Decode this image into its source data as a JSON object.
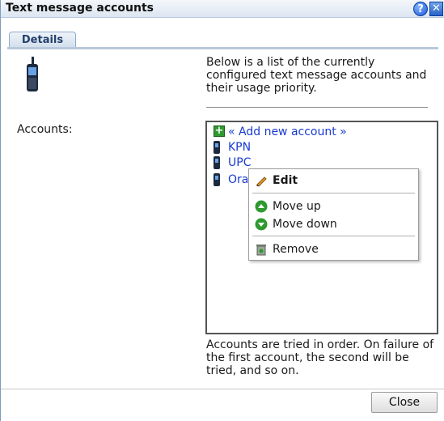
{
  "window": {
    "title": "Text message accounts"
  },
  "tabs": [
    {
      "label": "Details"
    }
  ],
  "intro_text": "Below is a list of the currently configured text message accounts and their usage priority.",
  "accounts_label": "Accounts:",
  "accounts_list": {
    "add_new_label": "« Add new account »",
    "items": [
      {
        "label": "KPN"
      },
      {
        "label": "UPC"
      },
      {
        "label": "Ora"
      }
    ]
  },
  "context_menu": {
    "edit_label": "Edit",
    "move_up_label": "Move up",
    "move_down_label": "Move down",
    "remove_label": "Remove"
  },
  "note": "Accounts are tried in order. On failure of the first account, the second will be tried, and so on.",
  "buttons": {
    "close_label": "Close"
  },
  "colors": {
    "link": "#1a3ad0",
    "accent": "#2a63c8",
    "ok_green": "#2e9a2e"
  }
}
